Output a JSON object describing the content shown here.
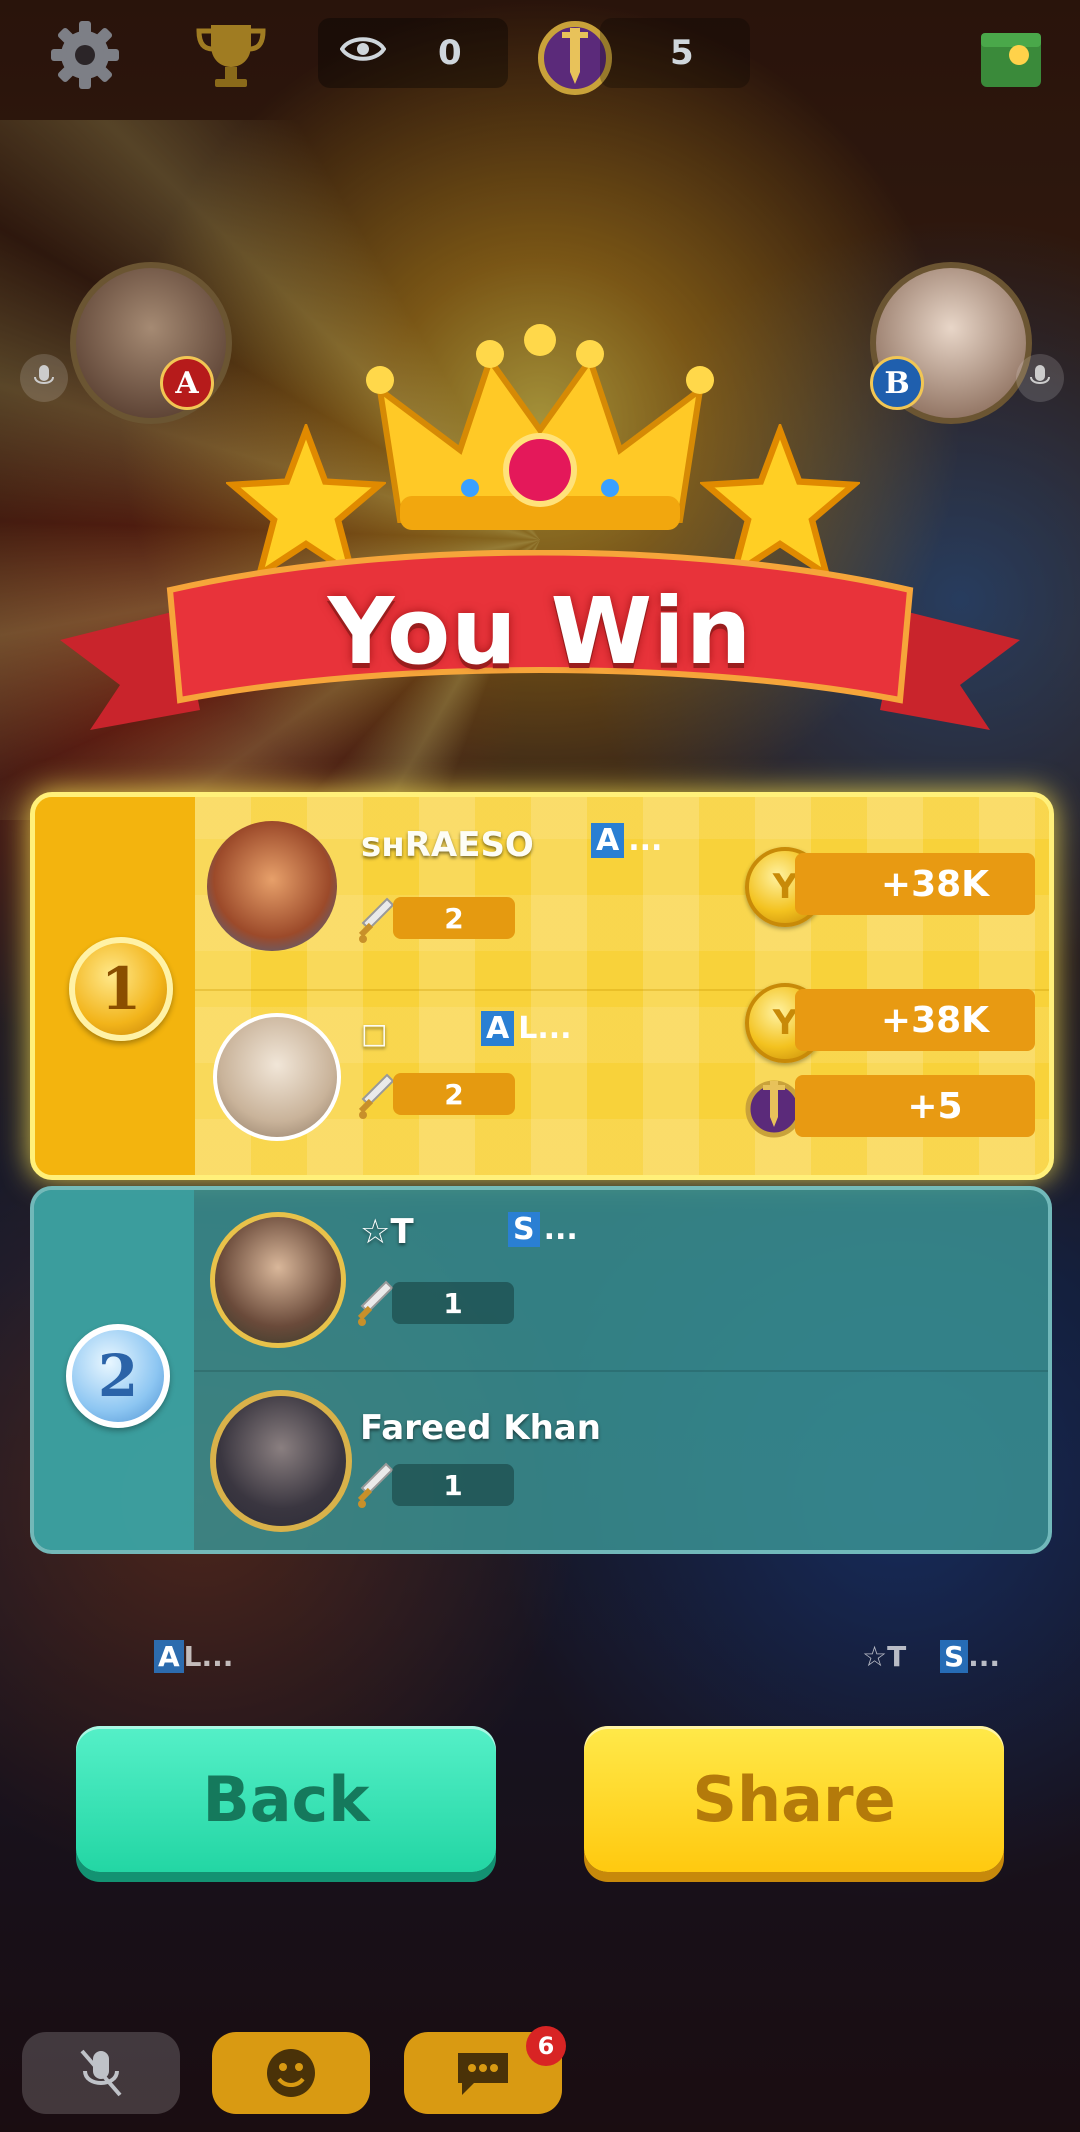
{
  "topbar": {
    "eye_count": "0",
    "shield_count": "5"
  },
  "title": "You Win",
  "winners": {
    "rank": "1",
    "players": [
      {
        "name": "ꜱʜRAESO",
        "tag_box": "A",
        "tag_rest": "...",
        "swords": "2",
        "coins": "+38K",
        "extra": ""
      },
      {
        "name": "□",
        "tag_box": "A",
        "tag_rest": "L...",
        "swords": "2",
        "coins": "+38K",
        "extra": "+5"
      }
    ]
  },
  "losers": {
    "rank": "2",
    "players": [
      {
        "name": "☆T",
        "tag_box": "S",
        "tag_rest": "...",
        "swords": "1"
      },
      {
        "name": "Fareed Khan",
        "swords": "1"
      }
    ]
  },
  "background_labels": {
    "left_box": "A",
    "left_rest": "L...",
    "right_name": "☆T",
    "right_box": "S",
    "right_rest": "..."
  },
  "buttons": {
    "back": "Back",
    "share": "Share"
  },
  "bottom_bar": {
    "chat_badge": "6"
  },
  "icons": [
    "gear-icon",
    "trophy-icon",
    "eye-icon",
    "shield-icon",
    "gift-icon",
    "crown-icon",
    "star-icon",
    "coin-icon",
    "sword-icon",
    "mic-muted-icon",
    "emoji-icon",
    "chat-icon"
  ],
  "colors": {
    "winner_panel": "#f6c21c",
    "loser_panel": "#3a9696",
    "back_button": "#23d6a4",
    "share_button": "#ffc90f",
    "banner_red": "#e8333a"
  }
}
